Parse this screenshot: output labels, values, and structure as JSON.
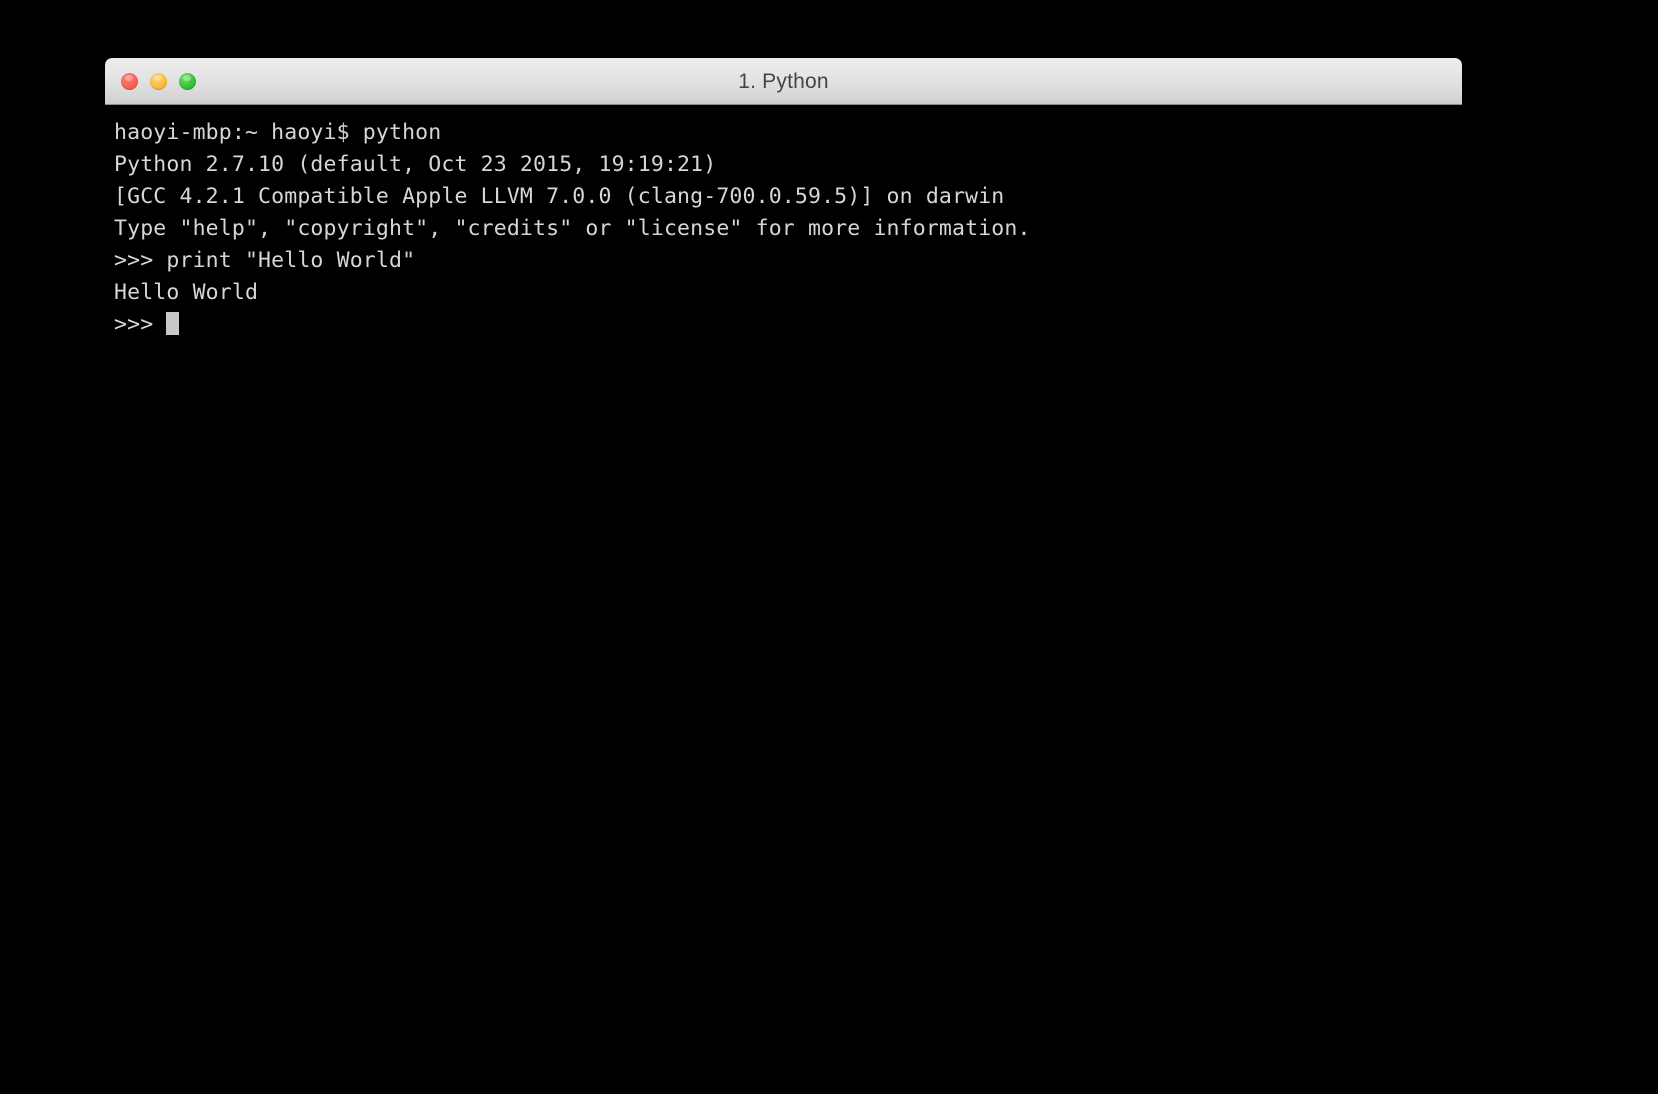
{
  "window": {
    "title": "1. Python",
    "controls": [
      {
        "name": "close-button",
        "label": "Close",
        "color": "#fa6158"
      },
      {
        "name": "minimize-button",
        "label": "Minimize",
        "color": "#fcbc40"
      },
      {
        "name": "maximize-button",
        "label": "Maximize",
        "color": "#39c13a"
      }
    ]
  },
  "terminal": {
    "background_color": "#000000",
    "text_color": "#d6d6d6",
    "cursor_color": "#c8c8c8",
    "lines": [
      "haoyi-mbp:~ haoyi$ python",
      "Python 2.7.10 (default, Oct 23 2015, 19:19:21)",
      "[GCC 4.2.1 Compatible Apple LLVM 7.0.0 (clang-700.0.59.5)] on darwin",
      "Type \"help\", \"copyright\", \"credits\" or \"license\" for more information.",
      ">>> print \"Hello World\"",
      "Hello World"
    ],
    "prompt": ">>> ",
    "cursor": "block"
  }
}
